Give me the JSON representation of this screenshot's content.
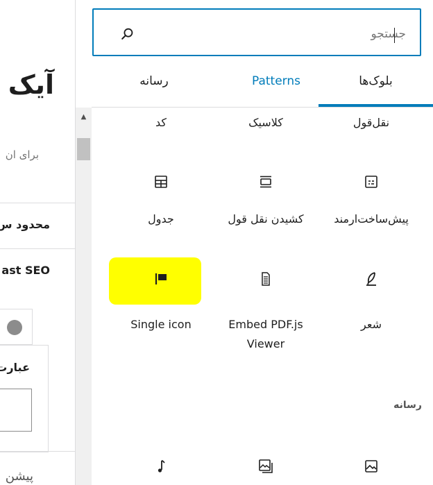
{
  "editor": {
    "title": "آیک",
    "description": "برای ان",
    "section_limit": "محدود س",
    "section_seo": "ast SEO",
    "focus_label": "عبارت",
    "preview_text": "پیشن"
  },
  "search": {
    "placeholder": "جستجو",
    "value": ""
  },
  "tabs": {
    "blocks": "بلوک‌ها",
    "patterns": "Patterns",
    "media": "رسانه"
  },
  "blocks_row1": [
    {
      "label": "نقل‌قول",
      "icon": "quote-icon"
    },
    {
      "label": "کلاسیک",
      "icon": "classic-icon"
    },
    {
      "label": "کد",
      "icon": "code-icon"
    }
  ],
  "blocks_row2": [
    {
      "label": "پیش‌ساخت‌ارمند",
      "icon": "preformatted-icon"
    },
    {
      "label": "کشیدن نقل قول",
      "icon": "pullquote-icon"
    },
    {
      "label": "جدول",
      "icon": "table-icon"
    }
  ],
  "blocks_row3": [
    {
      "label": "شعر",
      "icon": "verse-icon"
    },
    {
      "label": "Embed PDF.js Viewer",
      "icon": "document-icon"
    },
    {
      "label": "Single icon",
      "icon": "flag-icon"
    }
  ],
  "media_section": {
    "heading": "رسانه"
  },
  "media_blocks": [
    {
      "icon": "image-icon"
    },
    {
      "icon": "gallery-icon"
    },
    {
      "icon": "audio-icon"
    }
  ],
  "colors": {
    "accent": "#007cba",
    "highlight": "#ffff00"
  }
}
